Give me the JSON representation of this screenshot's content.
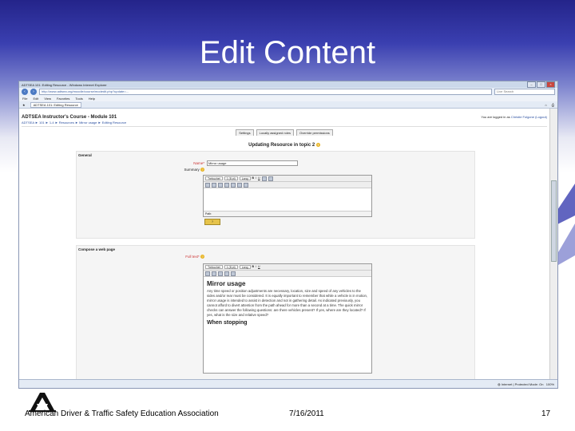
{
  "slide": {
    "title": "Edit Content",
    "footer_org": "American Driver & Traffic Safety Education Association",
    "footer_date": "7/16/2011",
    "footer_page": "17"
  },
  "browser": {
    "window_title": "ADTSEA 101: Editing Resource - Windows Internet Explorer",
    "url": "http://www.adtsea.org/moodle/course/modedit.php?update=...",
    "search_placeholder": "Live Search",
    "menu": [
      "File",
      "Edit",
      "View",
      "Favorites",
      "Tools",
      "Help"
    ],
    "favorites_tab": "ADTSEA 101: Editing Resource",
    "status_zone": "Internet | Protected Mode: On",
    "zoom": "100%"
  },
  "page": {
    "course_title": "ADTSEA Instructor's Course - Module 101",
    "login_text": "You are logged in as",
    "login_user": "Christie Folgone (Logout)",
    "breadcrumb": "ADTSEA ► 101 ► 1-4 ► Resources ► Mirror usage ► Editing Resource",
    "tabs": [
      "Settings",
      "Locally assigned roles",
      "Override permissions"
    ],
    "update_heading": "Updating Resource in topic 2",
    "general_label": "General",
    "name_label": "Name*",
    "name_value": "Mirror usage",
    "summary_label": "Summary",
    "font_select": "Trebuchet",
    "size_select": "1 (8 pt)",
    "lang_select": "Lang",
    "path_label": "Path:",
    "compose_label": "Compose a web page",
    "fulltext_label": "Full text*",
    "content_heading": "Mirror usage",
    "content_body": "Any time speed or position adjustments are necessary, location, size and speed of any vehicles to the sides and/or rear must be considered. It is equally important to remember that while a vehicle is in motion, mirror usage is intended to assist in detection and not in gathering detail. As indicated previously, you cannot afford to divert attention from the path ahead for more than a second at a time. The quick mirror checks can answer the following questions: are there vehicles present? If yes, where are they located? If yes, what is the size and relative speed?",
    "content_sub": "When stopping"
  }
}
